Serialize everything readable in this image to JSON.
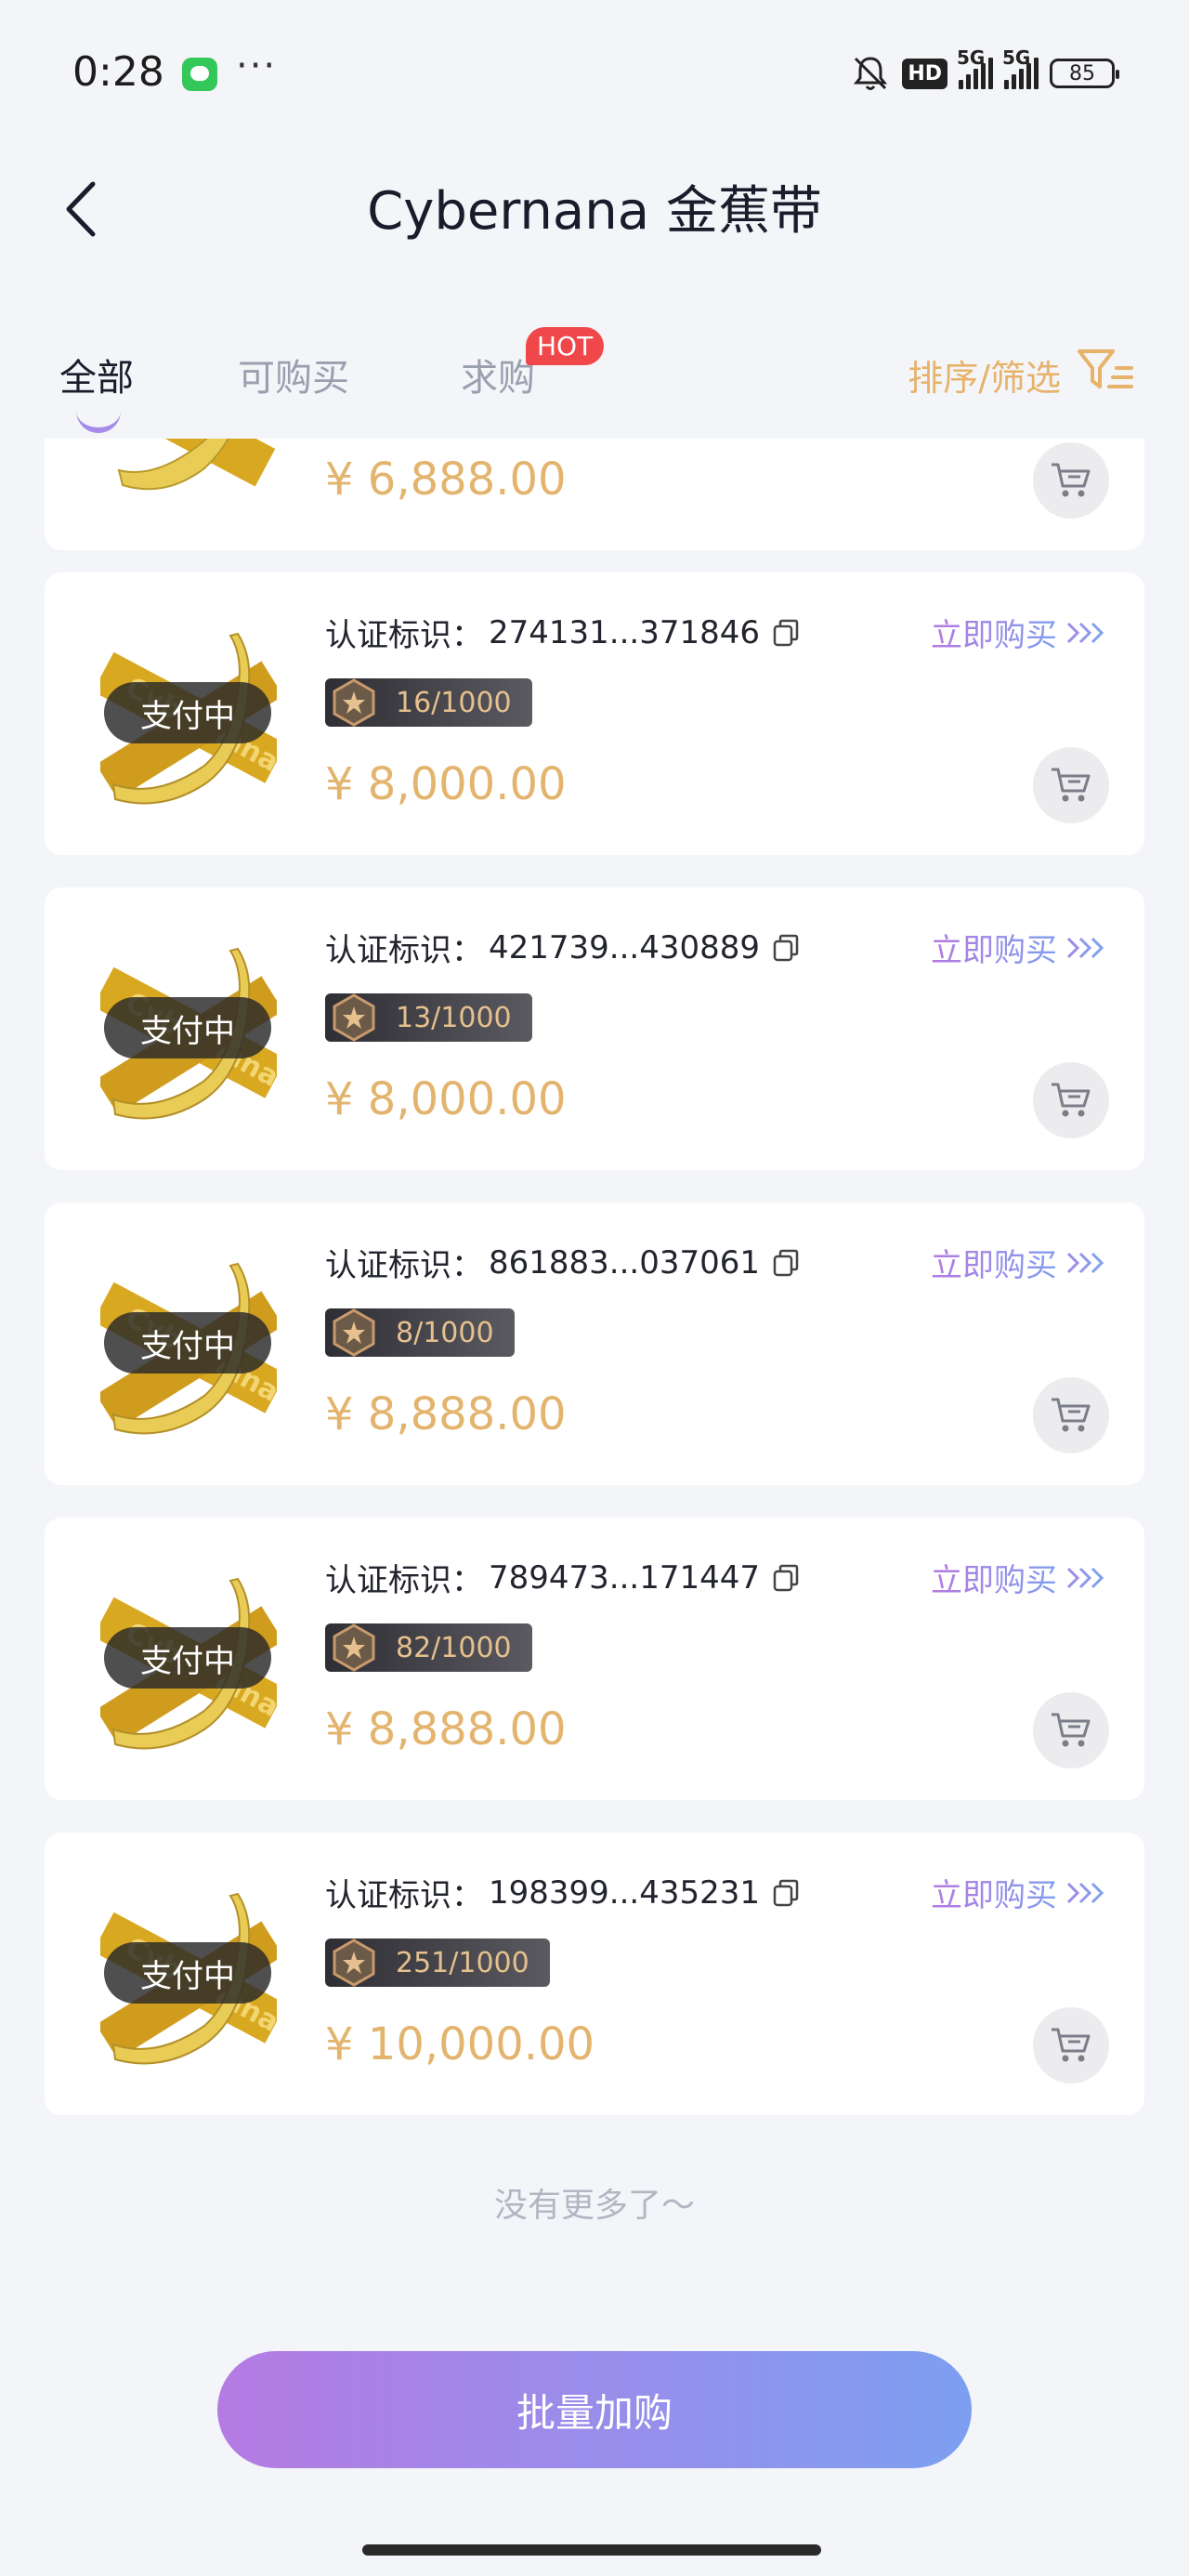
{
  "status_bar": {
    "time": "0:28",
    "hd_label": "HD",
    "signal1_label": "5G",
    "signal2_label": "5G",
    "battery": "85"
  },
  "header": {
    "title": "Cybernana 金蕉带",
    "back_icon": "chevron-left-icon"
  },
  "tabs": {
    "items": [
      {
        "label": "全部",
        "active": true
      },
      {
        "label": "可购买",
        "active": false
      },
      {
        "label": "求购",
        "active": false
      }
    ],
    "hot_badge": "HOT",
    "sort_label": "排序/筛选",
    "filter_icon": "filter-icon"
  },
  "partial_item": {
    "price": "¥ 6,888.00"
  },
  "items": [
    {
      "status": "支付中",
      "cert_label": "认证标识：",
      "cert_id": "274131...371846",
      "serial": "16/1000",
      "price": "¥ 8,000.00",
      "buy_label": "立即购买"
    },
    {
      "status": "支付中",
      "cert_label": "认证标识：",
      "cert_id": "421739...430889",
      "serial": "13/1000",
      "price": "¥ 8,000.00",
      "buy_label": "立即购买"
    },
    {
      "status": "支付中",
      "cert_label": "认证标识：",
      "cert_id": "861883...037061",
      "serial": "8/1000",
      "price": "¥ 8,888.00",
      "buy_label": "立即购买"
    },
    {
      "status": "支付中",
      "cert_label": "认证标识：",
      "cert_id": "789473...171447",
      "serial": "82/1000",
      "price": "¥ 8,888.00",
      "buy_label": "立即购买"
    },
    {
      "status": "支付中",
      "cert_label": "认证标识：",
      "cert_id": "198399...435231",
      "serial": "251/1000",
      "price": "¥ 10,000.00",
      "buy_label": "立即购买"
    }
  ],
  "footer": {
    "no_more": "没有更多了～",
    "bulk_button": "批量加购"
  },
  "colors": {
    "price": "#e3b46e",
    "accent_start": "#b57be3",
    "accent_end": "#7d9ff1",
    "hot": "#f0474a"
  }
}
